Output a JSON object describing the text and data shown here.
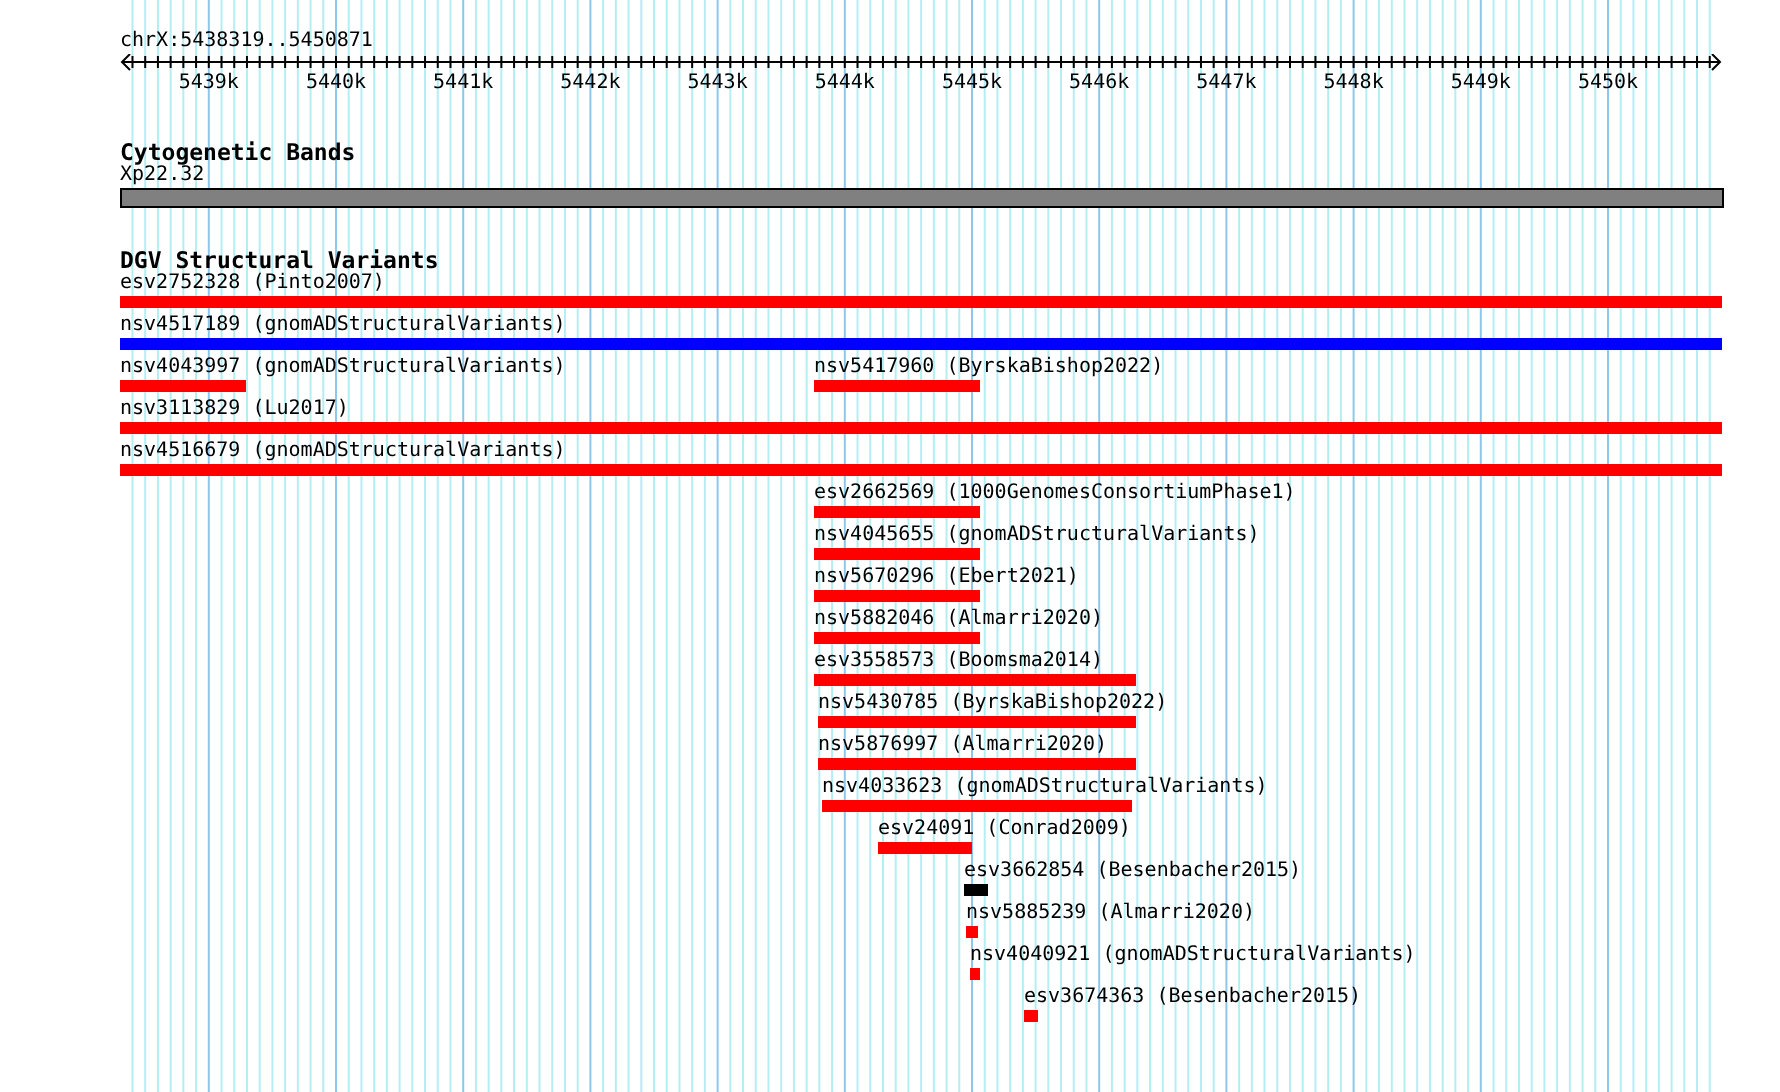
{
  "ruler": {
    "location": "chrX:5438319..5450871",
    "ticks": [
      "5439k",
      "5440k",
      "5441k",
      "5442k",
      "5443k",
      "5444k",
      "5445k",
      "5446k",
      "5447k",
      "5448k",
      "5449k",
      "5450k"
    ]
  },
  "cytogenetic_bands": {
    "title": "Cytogenetic Bands",
    "band": "Xp22.32"
  },
  "dgv": {
    "title": "DGV Structural Variants",
    "rows": [
      {
        "features": [
          {
            "label": "esv2752328 (Pinto2007)",
            "color": "#ff0000"
          }
        ]
      },
      {
        "features": [
          {
            "label": "nsv4517189 (gnomADStructuralVariants)",
            "color": "#0000ff"
          }
        ]
      },
      {
        "features": [
          {
            "label": "nsv4043997 (gnomADStructuralVariants)",
            "color": "#ff0000"
          },
          {
            "label": "nsv5417960 (ByrskaBishop2022)",
            "color": "#ff0000"
          }
        ]
      },
      {
        "features": [
          {
            "label": "nsv3113829 (Lu2017)",
            "color": "#ff0000"
          }
        ]
      },
      {
        "features": [
          {
            "label": "nsv4516679 (gnomADStructuralVariants)",
            "color": "#ff0000"
          }
        ]
      },
      {
        "features": [
          {
            "label": "esv2662569 (1000GenomesConsortiumPhase1)",
            "color": "#ff0000"
          }
        ]
      },
      {
        "features": [
          {
            "label": "nsv4045655 (gnomADStructuralVariants)",
            "color": "#ff0000"
          }
        ]
      },
      {
        "features": [
          {
            "label": "nsv5670296 (Ebert2021)",
            "color": "#ff0000"
          }
        ]
      },
      {
        "features": [
          {
            "label": "nsv5882046 (Almarri2020)",
            "color": "#ff0000"
          }
        ]
      },
      {
        "features": [
          {
            "label": "esv3558573 (Boomsma2014)",
            "color": "#ff0000"
          }
        ]
      },
      {
        "features": [
          {
            "label": "nsv5430785 (ByrskaBishop2022)",
            "color": "#ff0000"
          }
        ]
      },
      {
        "features": [
          {
            "label": "nsv5876997 (Almarri2020)",
            "color": "#ff0000"
          }
        ]
      },
      {
        "features": [
          {
            "label": "nsv4033623 (gnomADStructuralVariants)",
            "color": "#ff0000"
          }
        ]
      },
      {
        "features": [
          {
            "label": "esv24091 (Conrad2009)",
            "color": "#ff0000"
          }
        ]
      },
      {
        "features": [
          {
            "label": "esv3662854 (Besenbacher2015)",
            "color": "#000000"
          }
        ]
      },
      {
        "features": [
          {
            "label": "nsv5885239 (Almarri2020)",
            "color": "#ff0000"
          }
        ]
      },
      {
        "features": [
          {
            "label": "nsv4040921 (gnomADStructuralVariants)",
            "color": "#ff0000"
          }
        ]
      },
      {
        "features": [
          {
            "label": "esv3674363 (Besenbacher2015)",
            "color": "#ff0000"
          }
        ]
      }
    ]
  }
}
